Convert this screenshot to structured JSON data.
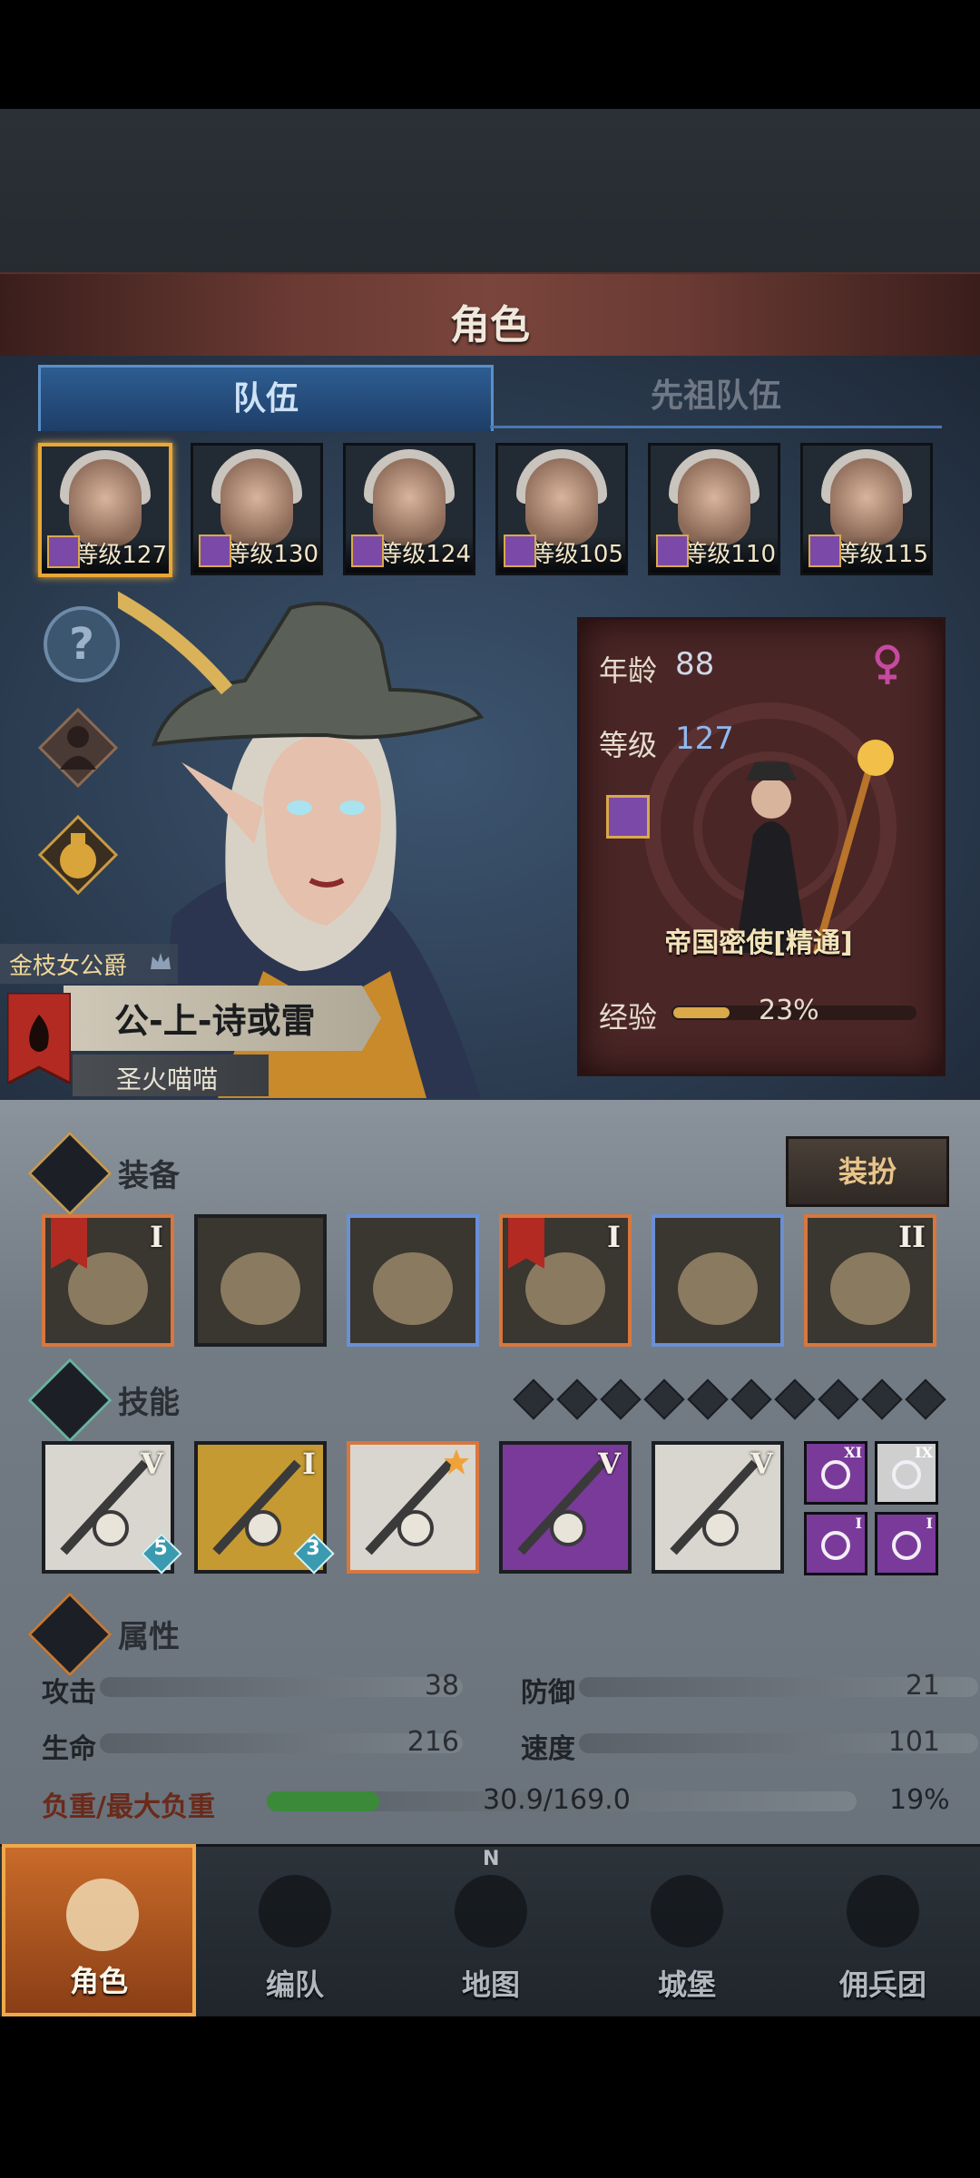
{
  "header": {
    "title": "角色"
  },
  "tabs": [
    {
      "label": "队伍"
    },
    {
      "label": "先祖队伍"
    }
  ],
  "team": [
    {
      "level": "等级127",
      "selected": true
    },
    {
      "level": "等级130",
      "selected": false
    },
    {
      "level": "等级124",
      "selected": false
    },
    {
      "level": "等级105",
      "selected": false
    },
    {
      "level": "等级110",
      "selected": false
    },
    {
      "level": "等级115",
      "selected": false
    }
  ],
  "side_icons": [
    "help-icon",
    "silhouette-icon",
    "potion-icon"
  ],
  "character": {
    "title": "金枝女公爵",
    "name": "公-上-诗或雷",
    "guild": "圣火喵喵",
    "age_label": "年龄",
    "age": "88",
    "level_label": "等级",
    "level": "127",
    "class_name": "帝国密使[精通]",
    "exp_label": "经验",
    "exp_percent": "23%",
    "exp_fraction": 0.23,
    "gender_icon": "female-icon"
  },
  "equipment": {
    "label": "装备",
    "dress_button": "装扮",
    "slots": [
      {
        "rank": "I",
        "frame": "orange",
        "flag": true,
        "icon": "golden-scarf-icon"
      },
      {
        "rank": "",
        "frame": "white",
        "flag": false,
        "icon": "panel-door-icon"
      },
      {
        "rank": "",
        "frame": "blue",
        "flag": false,
        "icon": "hood-icon"
      },
      {
        "rank": "I",
        "frame": "orange",
        "flag": true,
        "icon": "gold-armor-icon"
      },
      {
        "rank": "",
        "frame": "blue",
        "flag": false,
        "icon": "boots-icon"
      },
      {
        "rank": "II",
        "frame": "orange",
        "flag": false,
        "icon": "bat-amulet-icon"
      }
    ]
  },
  "skills": {
    "label": "技能",
    "slots": [
      {
        "rank": "V",
        "frame": "white",
        "bg": "#d9d6cf",
        "badge": "5",
        "icon": "spear-pray-icon"
      },
      {
        "rank": "I",
        "frame": "white",
        "bg": "#c59a32",
        "badge": "3",
        "icon": "shield-heal-icon"
      },
      {
        "rank": "",
        "frame": "orange",
        "bg": "#d9d6cf",
        "badge": "",
        "icon": "sword-pray-icon"
      },
      {
        "rank": "V",
        "frame": "white",
        "bg": "#7a3a9a",
        "badge": "",
        "icon": "crystal-hand-icon"
      },
      {
        "rank": "V",
        "frame": "white",
        "bg": "#d9d6cf",
        "badge": "",
        "icon": "crystal-hand-icon"
      }
    ],
    "small": [
      {
        "rank": "XI",
        "bg": "#7a3a9a",
        "icon": "wand-icon"
      },
      {
        "rank": "IX",
        "bg": "#cfcfcf",
        "icon": "burst-icon"
      },
      {
        "rank": "I",
        "bg": "#7a3a9a",
        "icon": "sun-cross-icon"
      },
      {
        "rank": "I",
        "bg": "#7a3a9a",
        "icon": "shield-icon"
      }
    ]
  },
  "attributes": {
    "label": "属性",
    "items": [
      {
        "label": "攻击",
        "value": "38"
      },
      {
        "label": "防御",
        "value": "21"
      },
      {
        "label": "生命",
        "value": "216"
      },
      {
        "label": "速度",
        "value": "101"
      }
    ],
    "load_label": "负重/最大负重",
    "load_value": "30.9/169.0",
    "load_percent": "19%",
    "load_fraction": 0.19
  },
  "nav": [
    {
      "label": "角色",
      "selected": true
    },
    {
      "label": "编队",
      "selected": false
    },
    {
      "label": "地图",
      "selected": false
    },
    {
      "label": "城堡",
      "selected": false
    },
    {
      "label": "佣兵团",
      "selected": false
    }
  ],
  "nav_compass": "N"
}
